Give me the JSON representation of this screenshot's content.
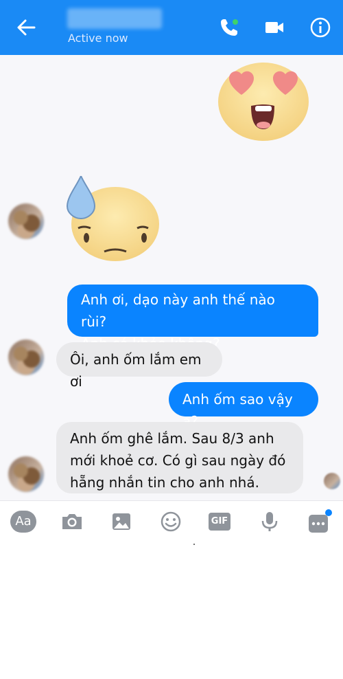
{
  "header": {
    "status": "Active now",
    "icons": [
      "back-arrow-icon",
      "phone-icon",
      "video-camera-icon",
      "info-icon"
    ]
  },
  "messages": [
    {
      "type": "emoji",
      "from": "me",
      "emoji": "heart-eyes"
    },
    {
      "type": "emoji",
      "from": "them",
      "emoji": "sweat"
    },
    {
      "type": "text",
      "from": "me",
      "lines": [
        "Anh ơi, dạo này anh thế nào rùi?",
        "Anh có khỏe không?"
      ]
    },
    {
      "type": "text",
      "from": "them",
      "lines": [
        "Ôi, anh ốm lắm em ơi"
      ]
    },
    {
      "type": "text",
      "from": "me",
      "lines": [
        "Anh ốm sao vậy ạ?"
      ]
    },
    {
      "type": "text",
      "from": "them",
      "lines": [
        "Anh ốm ghê lắm. Sau 8/3 anh",
        "mới khoẻ cơ. Có gì sau ngày đó",
        "hẵng nhắn tin cho anh nhá."
      ]
    }
  ],
  "composer": {
    "aa_label": "Aa",
    "gif_label": "GIF",
    "icons": [
      "camera-icon",
      "image-icon",
      "smiley-icon",
      "gif-icon",
      "microphone-icon",
      "more-icon"
    ]
  },
  "colors": {
    "header": "#1a8af5",
    "outgoing": "#0a84ff",
    "incoming": "#e9e9eb",
    "notification_dot": "#0a84ff"
  }
}
